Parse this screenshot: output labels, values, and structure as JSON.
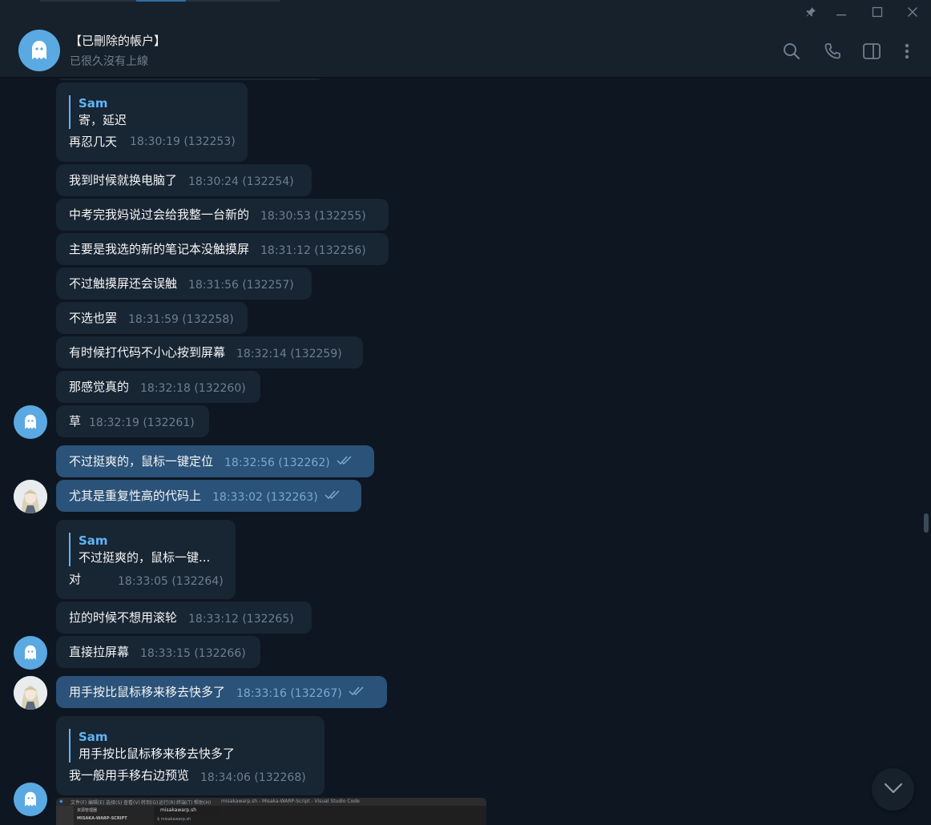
{
  "window": {
    "pin_icon": "pin-icon",
    "minimize_icon": "minimize-icon",
    "maximize_icon": "maximize-icon",
    "close_icon": "close-icon"
  },
  "header": {
    "title": "【已刪除的帳户】",
    "status": "已很久沒有上線",
    "avatar_icon": "ghost-icon",
    "actions": [
      "search-icon",
      "phone-icon",
      "sidebar-toggle-icon",
      "more-icon"
    ]
  },
  "colors": {
    "background": "#0e1621",
    "incoming_bubble": "#182533",
    "outgoing_bubble": "#2b5278",
    "accent": "#5eb5f7",
    "time_gray": "#6d7f8f"
  },
  "messages": [
    {
      "dir": "in",
      "reply": {
        "name": "Sam",
        "text": "寄，延迟"
      },
      "text": "再忍几天",
      "time": "18:30:19 (132253)"
    },
    {
      "dir": "in",
      "text": "我到时候就换电脑了",
      "time": "18:30:24 (132254)"
    },
    {
      "dir": "in",
      "text": "中考完我妈说过会给我整一台新的",
      "time": "18:30:53 (132255)"
    },
    {
      "dir": "in",
      "text": "主要是我选的新的笔记本没触摸屏",
      "time": "18:31:12 (132256)"
    },
    {
      "dir": "in",
      "text": "不过触摸屏还会误触",
      "time": "18:31:56 (132257)"
    },
    {
      "dir": "in",
      "text": "不选也罢",
      "time": "18:31:59 (132258)"
    },
    {
      "dir": "in",
      "text": "有时候打代码不小心按到屏幕",
      "time": "18:32:14 (132259)"
    },
    {
      "dir": "in",
      "text": "那感觉真的",
      "time": "18:32:18 (132260)"
    },
    {
      "dir": "in",
      "text": "草",
      "time": "18:32:19 (132261)"
    },
    {
      "dir": "out",
      "text": "不过挺爽的，鼠标一键定位",
      "time": "18:32:56 (132262)"
    },
    {
      "dir": "out",
      "text": "尤其是重复性高的代码上",
      "time": "18:33:02 (132263)"
    },
    {
      "dir": "in",
      "reply": {
        "name": "Sam",
        "text": "不过挺爽的，鼠标一键..."
      },
      "text": "对",
      "time": "18:33:05 (132264)"
    },
    {
      "dir": "in",
      "text": "拉的时候不想用滚轮",
      "time": "18:33:12 (132265)"
    },
    {
      "dir": "in",
      "text": "直接拉屏幕",
      "time": "18:33:15 (132266)"
    },
    {
      "dir": "out",
      "text": "用手按比鼠标移来移去快多了",
      "time": "18:33:16 (132267)"
    },
    {
      "dir": "in",
      "reply": {
        "name": "Sam",
        "text": "用手按比鼠标移来移去快多了"
      },
      "text": "我一般用手移右边预览",
      "time": "18:34:06 (132268)"
    }
  ],
  "image_preview": {
    "menu": [
      "文件(F)",
      "编辑(E)",
      "选择(S)",
      "查看(V)",
      "转到(G)",
      "运行(R)",
      "终端(T)",
      "帮助(H)"
    ],
    "window_title": "misakawarp.sh - Misaka-WARP-Script - Visual Studio Code",
    "explorer_title": "资源管理器",
    "explorer_item": "MISAKA-WARP-SCRIPT",
    "tab": "misakawarp.sh",
    "breadcrumb": "$ misakawarp.sh"
  },
  "scroll_down_icon": "chevron-down-icon"
}
